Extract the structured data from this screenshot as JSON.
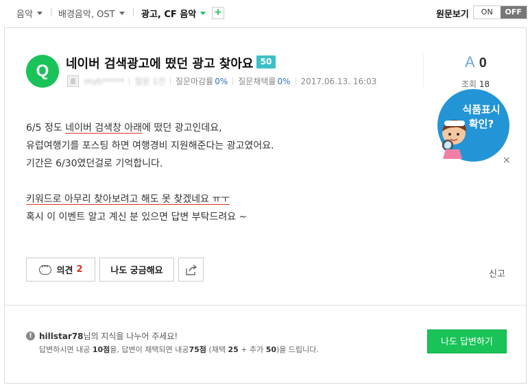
{
  "breadcrumb": {
    "items": [
      {
        "label": "음악"
      },
      {
        "label": "배경음악, OST"
      },
      {
        "label": "광고, CF 음악"
      }
    ],
    "add_label": "+"
  },
  "view_toggle": {
    "label": "원문보기",
    "on": "ON",
    "off": "OFF"
  },
  "question": {
    "badge": "Q",
    "title": "네이버 검색광고에 떴던 광고 찾아요 ~!",
    "points": "50",
    "author": "mytr*****",
    "answers_label": "질문 1건",
    "close_rate_label": "질문마감률",
    "close_rate": "0%",
    "select_rate_label": "질문채택률",
    "select_rate": "0%",
    "date": "2017.06.13. 16:03",
    "answer_icon": "A",
    "answer_count": "0",
    "views_label": "조회",
    "views": "18",
    "body": {
      "line1_pre": "6/5 정도 ",
      "line1_ul": "네이버 검색창 아래",
      "line1_post": "에 떴던 광고인데요,",
      "line2": "유럽여행기를 포스팅 하면 여행경비 지원해준다는 광고였어요.",
      "line3": "기간은 6/30였던걸로 기억합니다.",
      "line4_ul": "키워드로 아무리 찾아보려고 해도 못 찾겠네요 ㅠㅜ",
      "line5": "혹시 이 이벤트 알고 계신 분 있으면 답변 부탁드려요 ~"
    }
  },
  "ad": {
    "line1": "식품표시",
    "line2": "확인?",
    "close": "×"
  },
  "actions": {
    "comment_label": "의견",
    "comment_count": "2",
    "curious_label": "나도 궁금해요",
    "report_label": "신고"
  },
  "notice": {
    "user": "hillstar78",
    "line1_rest": "님의 지식을 나누어 주세요!",
    "line2_a": "답변하시면 내공 ",
    "line2_b": "10점",
    "line2_c": "을, 답변이 채택되면 내공",
    "line2_d": "75점",
    "line2_e": " (채택 ",
    "line2_f": "25",
    "line2_g": " + 추가 ",
    "line2_h": "50",
    "line2_i": ")을 드립니다.",
    "answer_button": "나도 답변하기"
  },
  "colors": {
    "brand": "#19c358",
    "points_badge": "#3cc0c7",
    "accent_red": "#d93025",
    "ad_blue": "#2395d6"
  }
}
